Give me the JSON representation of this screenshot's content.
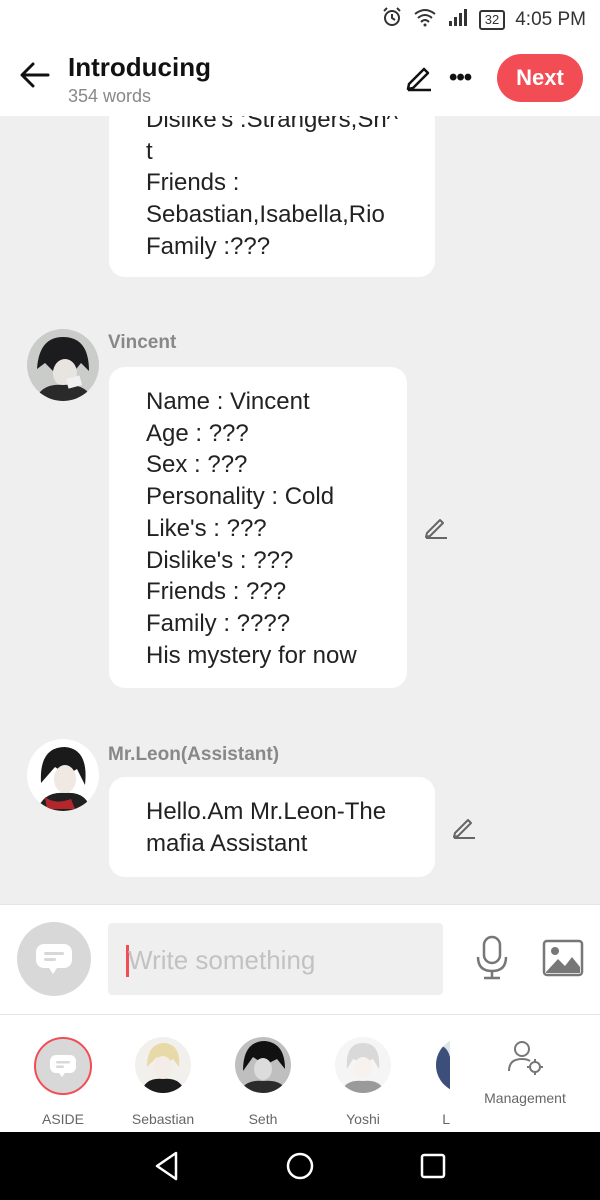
{
  "status": {
    "time": "4:05 PM",
    "battery": "32"
  },
  "header": {
    "title": "Introducing",
    "word_count": "354 words",
    "next_label": "Next"
  },
  "messages": [
    {
      "lines": [
        "Dislike's :Strangers,Sh^",
        "t",
        "Friends :",
        "Sebastian,Isabella,Rio",
        "Family :???"
      ]
    },
    {
      "sender": "Vincent",
      "lines": [
        "Name : Vincent",
        "Age : ???",
        "Sex : ???",
        "Personality : Cold",
        "Like's : ???",
        "Dislike's : ???",
        "Friends : ???",
        "Family : ????",
        "His mystery for now"
      ]
    },
    {
      "sender": "Mr.Leon(Assistant)",
      "lines": [
        "Hello.Am Mr.Leon-The",
        "mafia Assistant"
      ]
    }
  ],
  "composer": {
    "placeholder": "Write something"
  },
  "characters": [
    {
      "name": "ASIDE"
    },
    {
      "name": "Sebastian"
    },
    {
      "name": "Seth"
    },
    {
      "name": "Yoshi"
    },
    {
      "name": "L"
    }
  ],
  "management_label": "Management",
  "colors": {
    "accent": "#f24c55",
    "background": "#efefef",
    "bubble": "#ffffff"
  }
}
